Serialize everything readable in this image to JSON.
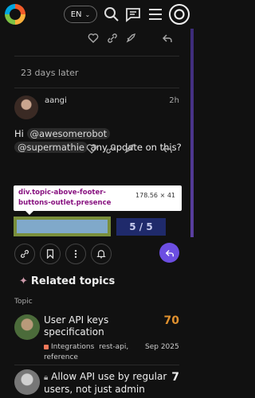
{
  "header": {
    "language_label": "EN",
    "icons": [
      "logo-icon",
      "chevron-down-icon",
      "search-icon",
      "chat-icon",
      "hamburger-icon",
      "user-avatar"
    ]
  },
  "post_actions_top": [
    "heart-icon",
    "link-icon",
    "rocket-icon",
    "reply-icon"
  ],
  "time_gap": "23 days later",
  "post": {
    "username": "aangi",
    "time": "2h",
    "text_prefix": "Hi",
    "mentions": [
      "@awesomerobot",
      "@supermathie"
    ],
    "text_suffix": "any update on this?"
  },
  "post_actions": [
    "heart-icon",
    "link-icon",
    "rocket-icon",
    "reply-icon"
  ],
  "devtools_tooltip": {
    "selector": "div.topic-above-footer-buttons-outlet.presence",
    "dimensions": "178.56 × 41"
  },
  "progress": "5 / 5",
  "timeline_controls": [
    "link-icon",
    "bookmark-icon",
    "more-icon",
    "bell-icon",
    "reply-icon"
  ],
  "related": {
    "title": "Related topics",
    "column_header": "Topic",
    "topics": [
      {
        "title": "User API keys specification",
        "count": "70",
        "count_color": "#e0912f",
        "category": "Integrations",
        "category_color": "#f0785a",
        "tags": "rest-api,",
        "tags2": "reference",
        "date": "Sep 2025"
      },
      {
        "title": "Allow API use by regular users, not just admin",
        "count": "7",
        "count_color": "#eeeeee",
        "locked": true
      }
    ]
  },
  "colors": {
    "accent": "#6c4ee2",
    "progress_bg": "#1f2a6b",
    "background": "#111111"
  }
}
